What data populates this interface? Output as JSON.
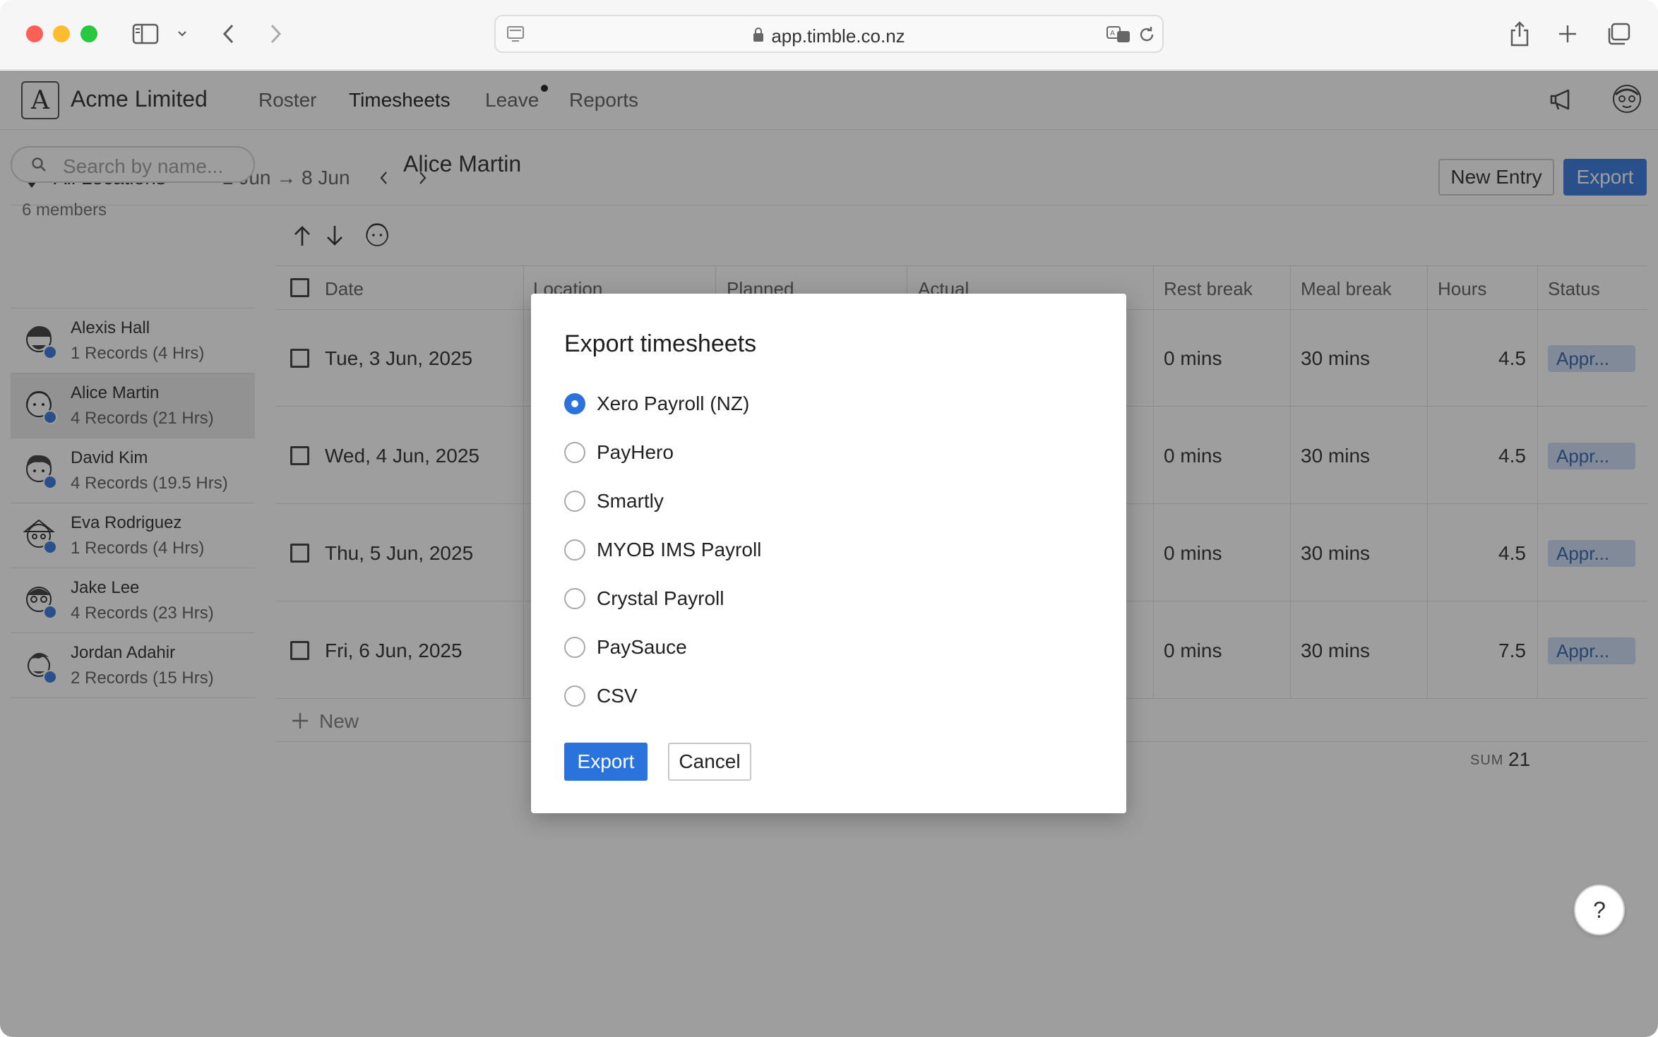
{
  "browser": {
    "url": "app.timble.co.nz"
  },
  "app": {
    "company": "Acme Limited",
    "logo_letter": "A",
    "nav": [
      "Roster",
      "Timesheets",
      "Leave",
      "Reports"
    ]
  },
  "toolbar": {
    "location": "All Locations",
    "date_range": "2 Jun → 8 Jun",
    "new_entry": "New Entry",
    "export": "Export"
  },
  "sidebar": {
    "search_placeholder": "Search by name...",
    "members_count": "6 members",
    "members": [
      {
        "name": "Alexis Hall",
        "records": "1 Records (4 Hrs)"
      },
      {
        "name": "Alice Martin",
        "records": "4 Records (21 Hrs)"
      },
      {
        "name": "David Kim",
        "records": "4 Records (19.5 Hrs)"
      },
      {
        "name": "Eva Rodriguez",
        "records": "1 Records (4 Hrs)"
      },
      {
        "name": "Jake Lee",
        "records": "4 Records (23 Hrs)"
      },
      {
        "name": "Jordan Adahir",
        "records": "2 Records (15 Hrs)"
      }
    ]
  },
  "main": {
    "person": "Alice Martin",
    "columns": [
      "Date",
      "Location",
      "Planned",
      "Actual",
      "Rest break",
      "Meal break",
      "Hours",
      "Status"
    ],
    "rows": [
      {
        "date": "Tue, 3 Jun, 2025",
        "rest": "0 mins",
        "meal": "30 mins",
        "hours": "4.5",
        "status": "Appr..."
      },
      {
        "date": "Wed, 4 Jun, 2025",
        "rest": "0 mins",
        "meal": "30 mins",
        "hours": "4.5",
        "status": "Appr..."
      },
      {
        "date": "Thu, 5 Jun, 2025",
        "rest": "0 mins",
        "meal": "30 mins",
        "hours": "4.5",
        "status": "Appr..."
      },
      {
        "date": "Fri, 6 Jun, 2025",
        "rest": "0 mins",
        "meal": "30 mins",
        "hours": "7.5",
        "status": "Appr..."
      }
    ],
    "new_label": "New",
    "sum_label": "SUM",
    "sum_value": "21"
  },
  "help_label": "?",
  "modal": {
    "title": "Export timesheets",
    "options": [
      "Xero Payroll (NZ)",
      "PayHero",
      "Smartly",
      "MYOB IMS Payroll",
      "Crystal Payroll",
      "PaySauce",
      "CSV"
    ],
    "selected": "Xero Payroll (NZ)",
    "export_label": "Export",
    "cancel_label": "Cancel"
  }
}
